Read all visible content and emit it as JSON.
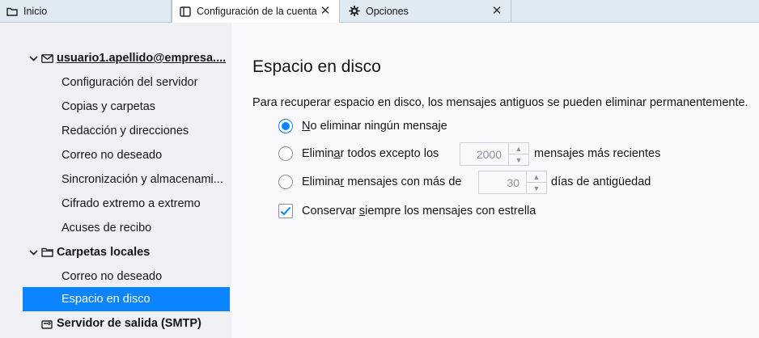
{
  "tabs": [
    {
      "label": "Inicio",
      "icon": "folder-icon"
    },
    {
      "label": "Configuración de la cuenta",
      "icon": "account-settings-icon",
      "active": true
    },
    {
      "label": "Opciones",
      "icon": "gear-icon"
    }
  ],
  "sidebar": {
    "account": "usuario1.apellido@empresa....",
    "account_items": [
      "Configuración del servidor",
      "Copias y carpetas",
      "Redacción y direcciones",
      "Correo no deseado",
      "Sincronización y almacenami...",
      "Cifrado extremo a extremo",
      "Acuses de recibo"
    ],
    "local_folders": "Carpetas locales",
    "local_items": [
      "Correo no deseado",
      "Espacio en disco"
    ],
    "smtp": "Servidor de salida (SMTP)"
  },
  "main": {
    "title": "Espacio en disco",
    "description": "Para recuperar espacio en disco, los mensajes antiguos se pueden eliminar permanentemente.",
    "opt1": {
      "accel": "N",
      "rest": "o eliminar ningún mensaje",
      "selected": true
    },
    "opt2": {
      "pre": "Elimin",
      "accel": "a",
      "rest": "r todos excepto los",
      "value": "2000",
      "suffix": "mensajes más recientes"
    },
    "opt3": {
      "pre": "Elimina",
      "accel": "r",
      "rest": " mensajes con más de",
      "value": "30",
      "suffix": "días de antigüedad"
    },
    "keep": {
      "pre": "Conservar ",
      "accel": "s",
      "rest": "iempre los mensajes con estrella",
      "checked": true
    }
  },
  "colors": {
    "accent": "#0a84ff",
    "tabbar": "#dfeaf2",
    "sidebar": "#f0f0f4",
    "content": "#f9f9fb"
  }
}
